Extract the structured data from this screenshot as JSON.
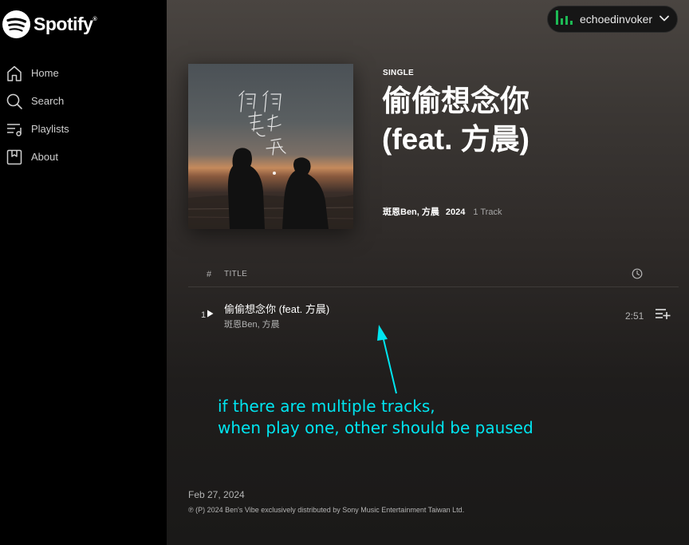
{
  "brand": {
    "name": "Spotify",
    "mark": "®"
  },
  "sidebar": {
    "items": [
      {
        "label": "Home",
        "icon": "home-icon"
      },
      {
        "label": "Search",
        "icon": "search-icon"
      },
      {
        "label": "Playlists",
        "icon": "playlists-icon"
      },
      {
        "label": "About",
        "icon": "about-icon"
      }
    ]
  },
  "user": {
    "name": "echoedinvoker"
  },
  "album": {
    "type_label": "SINGLE",
    "title_line1": "偷偷想念你",
    "title_line2": "(feat. 方晨)",
    "artists": "斑恩Ben, 方晨",
    "year": "2024",
    "track_count": "1 Track"
  },
  "tracks_header": {
    "num": "#",
    "title": "TITLE"
  },
  "tracks": [
    {
      "num": "1",
      "title": "偷偷想念你 (feat. 方晨)",
      "artists": "斑恩Ben, 方晨",
      "duration": "2:51"
    }
  ],
  "annotation": {
    "line1": "if there are multiple tracks,",
    "line2": "when play one, other should be paused",
    "color": "#00e5f0"
  },
  "footer": {
    "release_date": "Feb 27, 2024",
    "copyright": "℗ (P) 2024 Ben's Vibe exclusively distributed by Sony Music Entertainment Taiwan Ltd."
  },
  "colors": {
    "accent": "#1db954",
    "background": "#000000"
  }
}
